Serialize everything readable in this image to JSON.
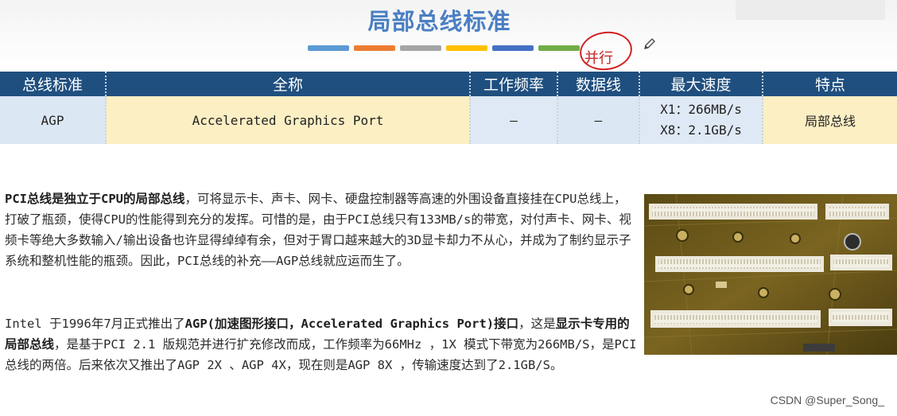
{
  "slide": {
    "title": "局部总线标准",
    "accent_bars": [
      "#5b9bd5",
      "#ed7d31",
      "#a5a5a5",
      "#ffc000",
      "#4472c4",
      "#70ad47"
    ],
    "annotation": "并行"
  },
  "table": {
    "headers": [
      "总线标准",
      "全称",
      "工作频率",
      "数据线",
      "最大速度",
      "特点"
    ],
    "row": {
      "standard": "AGP",
      "full_name": "Accelerated Graphics Port",
      "frequency": "—",
      "data_lines": "—",
      "speed_1": "X1：266MB/s",
      "speed_2": "X8：2.1GB/s",
      "feature": "局部总线"
    }
  },
  "paragraph1": {
    "bold": "PCI总线是独立于CPU的局部总线",
    "rest": "，可将显示卡、声卡、网卡、硬盘控制器等高速的外围设备直接挂在CPU总线上，打破了瓶颈，使得CPU的性能得到充分的发挥。可惜的是，由于PCI总线只有133MB/s的带宽，对付声卡、网卡、视频卡等绝大多数输入/输出设备也许显得绰绰有余，但对于胃口越来越大的3D显卡却力不从心，并成为了制约显示子系统和整机性能的瓶颈。因此，PCI总线的补充——AGP总线就应运而生了。"
  },
  "paragraph2": {
    "part1": "Intel 于1996年7月正式推出了",
    "bold1": "AGP(加速图形接口，Accelerated Graphics Port)接口",
    "part2": "，这是",
    "bold2": "显示卡专用的局部总线",
    "part3": "，是基于PCI 2.1 版规范并进行扩充修改而成，工作频率为66MHz ，1X 模式下带宽为266MB/S，是PCI总线的两倍。后来依次又推出了AGP 2X 、AGP 4X，现在则是AGP 8X ，传输速度达到了2.1GB/S。"
  },
  "watermark": "CSDN @Super_Song_"
}
